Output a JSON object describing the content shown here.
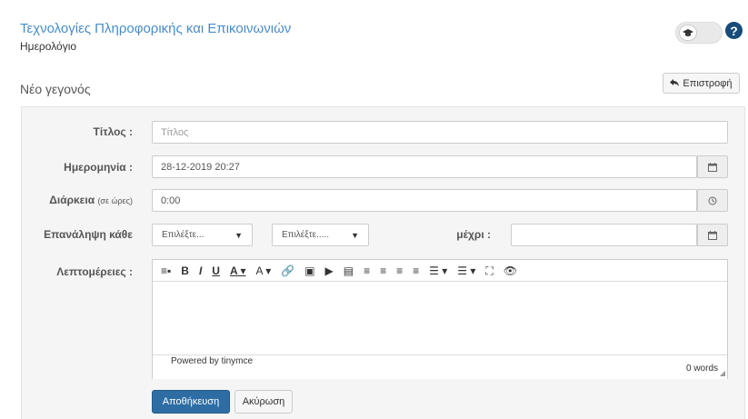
{
  "header": {
    "course_title": "Τεχνολογίες Πληροφορικής και Επικοινωνιών",
    "section": "Ημερολόγιο",
    "toggle_icon": "graduation-cap-icon",
    "help_glyph": "?"
  },
  "page": {
    "heading": "Νέο γεγονός",
    "back_label": "Επιστροφή"
  },
  "form": {
    "title": {
      "label": "Τίτλος :",
      "placeholder": "Τίτλος"
    },
    "date": {
      "label": "Ημερομηνία :",
      "value": "28-12-2019 20:27"
    },
    "duration": {
      "label": "Διάρκεια",
      "label_note": "(σε ώρες)",
      "value": "0:00"
    },
    "repeat": {
      "label": "Επανάληψη κάθε",
      "select1": "Επιλέξτε...",
      "select2": "Επιλέξτε.....",
      "until_label": "μέχρι :"
    },
    "details": {
      "label": "Λεπτομέρειες :"
    }
  },
  "editor": {
    "toolbar": [
      "≡▪",
      "B",
      "I",
      "U",
      "A ▾",
      "A ▾",
      "🔗",
      "▣",
      "▶",
      "▤",
      "≡",
      "≡",
      "≡",
      "≡",
      "☰ ▾",
      "☰ ▾",
      "⛶",
      "👁"
    ],
    "powered_by": "Powered by tinymce",
    "word_count": "0 words"
  },
  "buttons": {
    "save": "Αποθήκευση",
    "cancel": "Ακύρωση"
  },
  "colors": {
    "link_blue": "#4a8cc7",
    "primary": "#2e6da4",
    "help": "#164b7a"
  }
}
